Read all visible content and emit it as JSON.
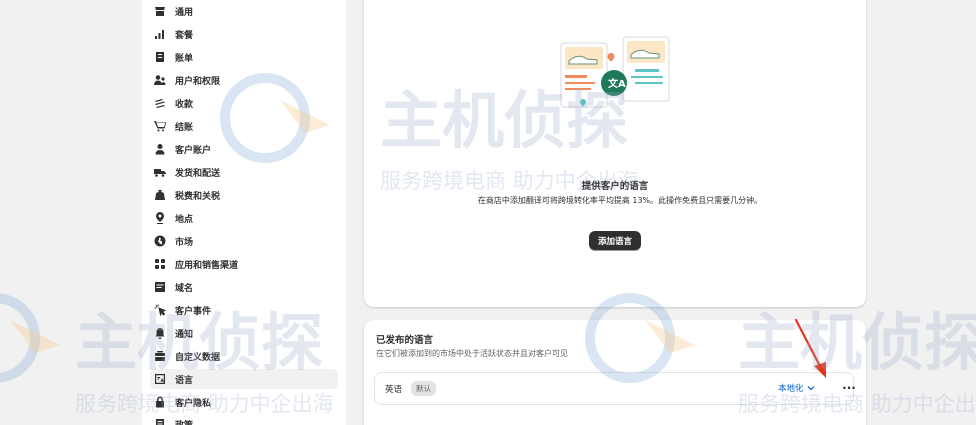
{
  "sidebar": {
    "items": [
      {
        "label": "通用",
        "icon": "store-icon"
      },
      {
        "label": "套餐",
        "icon": "plan-chart-icon"
      },
      {
        "label": "账单",
        "icon": "billing-icon"
      },
      {
        "label": "用户和权限",
        "icon": "users-icon"
      },
      {
        "label": "收款",
        "icon": "payments-icon"
      },
      {
        "label": "结账",
        "icon": "cart-icon"
      },
      {
        "label": "客户账户",
        "icon": "person-icon"
      },
      {
        "label": "发货和配送",
        "icon": "truck-icon"
      },
      {
        "label": "税费和关税",
        "icon": "tax-bag-icon"
      },
      {
        "label": "地点",
        "icon": "location-icon"
      },
      {
        "label": "市场",
        "icon": "globe-icon"
      },
      {
        "label": "应用和销售渠道",
        "icon": "apps-icon"
      },
      {
        "label": "域名",
        "icon": "domain-icon"
      },
      {
        "label": "客户事件",
        "icon": "cursor-click-icon"
      },
      {
        "label": "通知",
        "icon": "bell-icon"
      },
      {
        "label": "自定义数据",
        "icon": "data-icon"
      },
      {
        "label": "语言",
        "icon": "language-icon"
      },
      {
        "label": "客户隐私",
        "icon": "lock-icon"
      },
      {
        "label": "政策",
        "icon": "policy-icon"
      }
    ],
    "active_index": 16
  },
  "empty_state": {
    "title": "提供客户的语言",
    "description": "在商店中添加翻译可将跨境转化率平均提高 13%。此操作免费且只需要几分钟。",
    "button_label": "添加语言",
    "illustration_icon": "translate-illustration"
  },
  "published": {
    "title": "已发布的语言",
    "description": "在它们被添加到的市场中处于活跃状态并且对客户可见",
    "languages": [
      {
        "name": "英语",
        "badge": "默认",
        "action_label": "本地化",
        "more_label": "···"
      }
    ]
  },
  "watermark": {
    "brand_text": "主机侦探",
    "tagline": "服务跨境电商 助力中企出海"
  },
  "colors": {
    "accent_link": "#005bd3",
    "primary_button": "#303030",
    "annotation_arrow": "#e8341c"
  }
}
